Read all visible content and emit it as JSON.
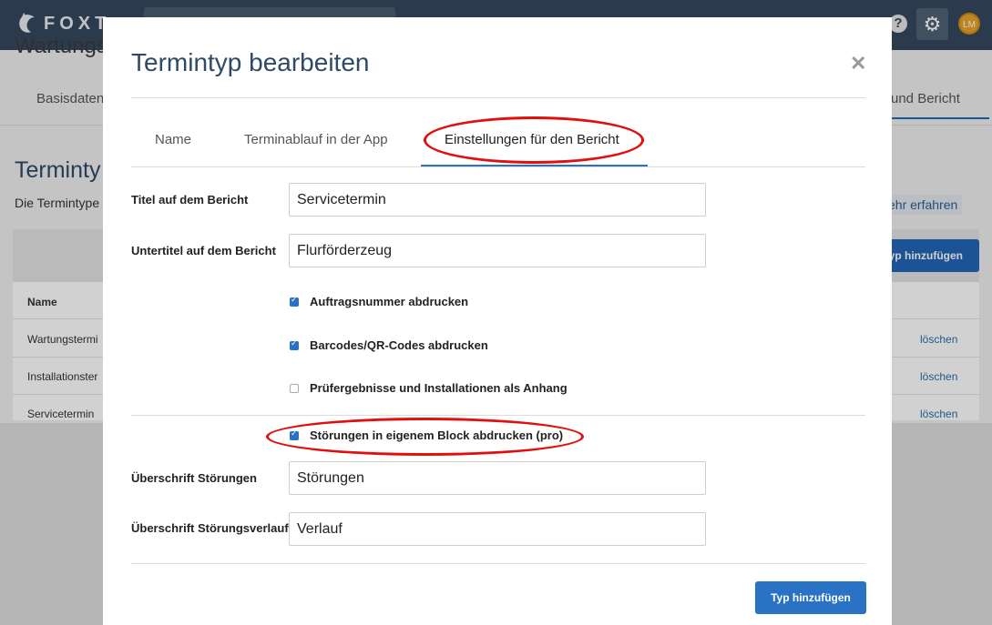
{
  "brand": {
    "name": "FOXT"
  },
  "header": {
    "help_icon": "question-icon",
    "settings_icon": "gear-icon",
    "avatar_initials": "LM"
  },
  "background": {
    "heading": "Wartungst",
    "tab_first": "Basisdaten",
    "tab_last": "und Bericht",
    "title": "Terminty",
    "description": "Die Termintype",
    "learn_more": "ehr erfahren",
    "add_button": "yp hinzufügen",
    "table": {
      "column_name": "Name",
      "rows": [
        {
          "name": "Wartungstermi",
          "delete": "löschen"
        },
        {
          "name": "Installationster",
          "delete": "löschen"
        },
        {
          "name": "Servicetermin",
          "delete": "löschen"
        }
      ]
    }
  },
  "modal": {
    "title": "Termintyp bearbeiten",
    "close_icon": "close-icon",
    "tabs": [
      {
        "label": "Name",
        "active": false
      },
      {
        "label": "Terminablauf in der App",
        "active": false
      },
      {
        "label": "Einstellungen für den Bericht",
        "active": true
      }
    ],
    "fields": {
      "title_label": "Titel auf dem Bericht",
      "title_value": "Servicetermin",
      "subtitle_label": "Untertitel auf dem Bericht",
      "subtitle_value": "Flurförderzeug",
      "faults_heading_label": "Überschrift Störungen",
      "faults_heading_value": "Störungen",
      "fault_history_label": "Überschrift Störungsverlauf",
      "fault_history_value": "Verlauf"
    },
    "checkboxes": [
      {
        "label": "Auftragsnummer abdrucken",
        "checked": true
      },
      {
        "label": "Barcodes/QR-Codes abdrucken",
        "checked": true
      },
      {
        "label": "Prüfergebnisse und Installationen als Anhang",
        "checked": false
      },
      {
        "label": "Störungen in eigenem Block abdrucken (pro)",
        "checked": true
      }
    ],
    "primary_button": "Typ hinzufügen"
  },
  "colors": {
    "accent": "#2a72c4",
    "header": "#35495e",
    "annotation": "#e20f0f"
  }
}
